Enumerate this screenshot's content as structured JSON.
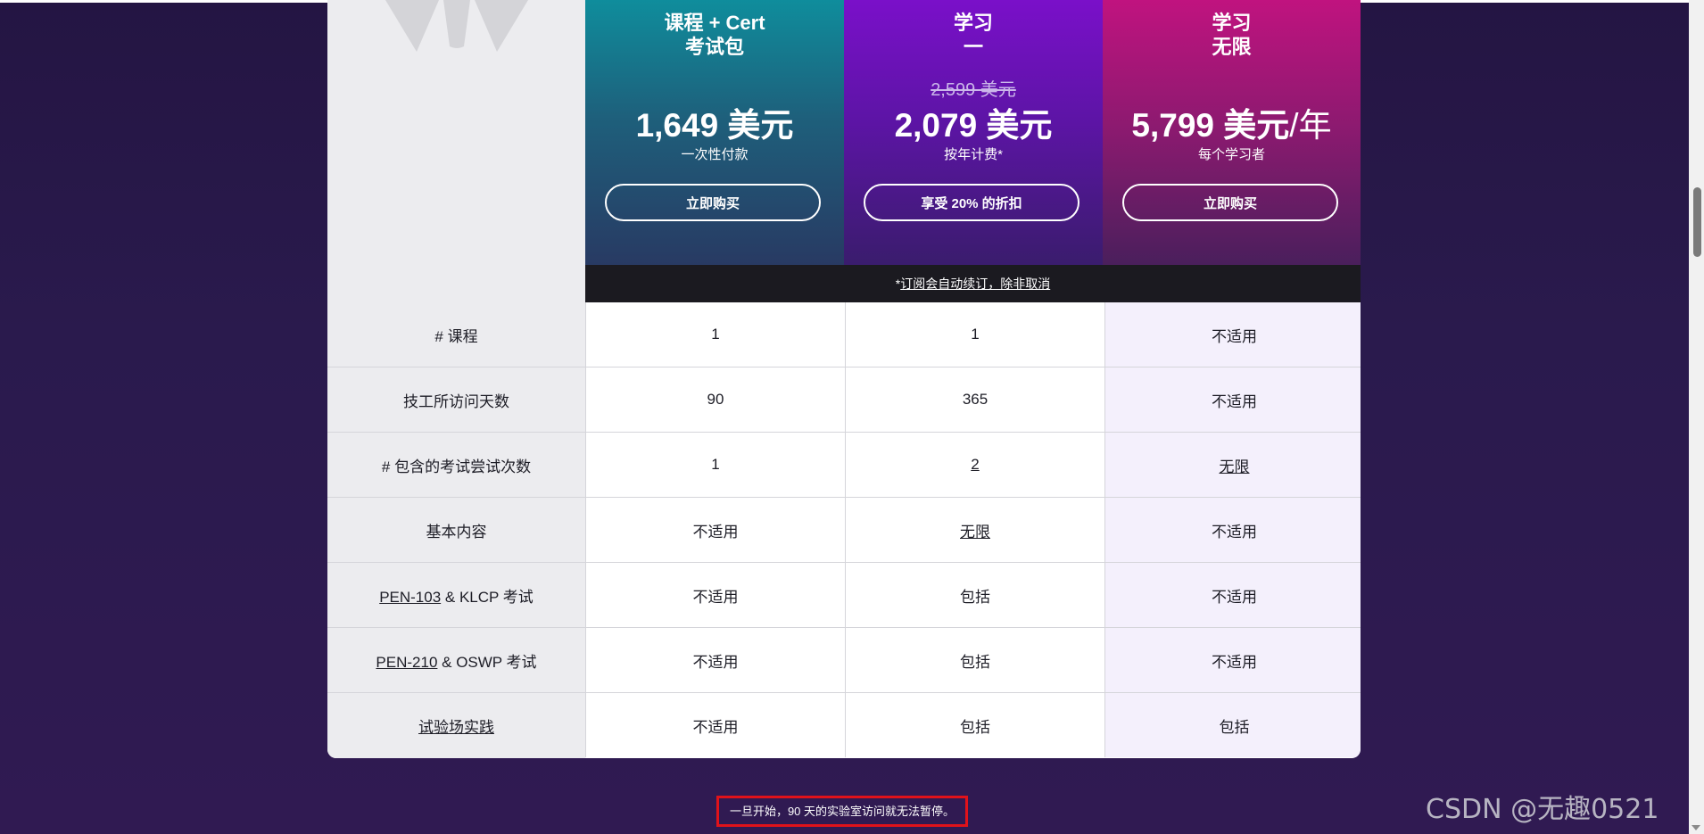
{
  "plans": [
    {
      "name_line1": "课程 + Cert",
      "name_line2": "考试包",
      "old_price": "",
      "price": "1,649 美元",
      "price_suffix": "",
      "price_note": "一次性付款",
      "button_label": "立即购买"
    },
    {
      "name_line1": "学习",
      "name_line2": "一",
      "old_price": "2,599 美元",
      "price": "2,079 美元",
      "price_suffix": "",
      "price_note": "按年计费*",
      "button_label": "享受 20% 的折扣"
    },
    {
      "name_line1": "学习",
      "name_line2": "无限",
      "old_price": "",
      "price": "5,799 美元",
      "price_suffix": "/年",
      "price_note": "每个学习者",
      "button_label": "立即购买"
    }
  ],
  "renewal": {
    "prefix": "*",
    "text": "订阅会自动续订，除非取消"
  },
  "rows": [
    {
      "label": "# 课程",
      "label_link": "",
      "label_rest": "",
      "values": [
        "1",
        "1",
        "不适用"
      ]
    },
    {
      "label": "技工所访问天数",
      "label_link": "",
      "label_rest": "",
      "values": [
        "90",
        "365",
        "不适用"
      ]
    },
    {
      "label": "# 包含的考试尝试次数",
      "label_link": "",
      "label_rest": "",
      "values": [
        "1",
        "2",
        "无限"
      ]
    },
    {
      "label": "基本内容",
      "label_link": "",
      "label_rest": "",
      "values": [
        "不适用",
        "无限",
        "不适用"
      ]
    },
    {
      "label": "",
      "label_link": "PEN-103",
      "label_rest": " & KLCP 考试",
      "values": [
        "不适用",
        "包括",
        "不适用"
      ]
    },
    {
      "label": "",
      "label_link": "PEN-210",
      "label_rest": " & OSWP 考试",
      "values": [
        "不适用",
        "包括",
        "不适用"
      ]
    },
    {
      "label": "",
      "label_link": "试验场实践",
      "label_rest": "",
      "values": [
        "不适用",
        "包括",
        "包括"
      ]
    }
  ],
  "footnote": "一旦开始，90 天的实验室访问就无法暂停。",
  "watermark": "CSDN @无趣0521"
}
